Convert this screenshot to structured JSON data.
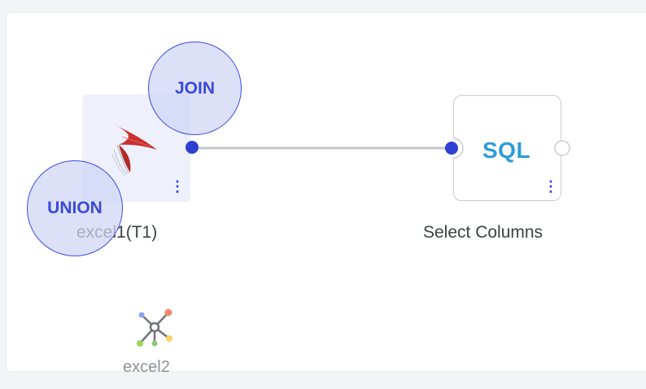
{
  "nodes": {
    "source": {
      "label": "excel1(T1)",
      "more": "⋮"
    },
    "sql": {
      "badge": "SQL",
      "label": "Select Columns",
      "more": "⋮"
    },
    "unconnected": {
      "label": "excel2"
    }
  },
  "actions": {
    "join": "JOIN",
    "union": "UNION"
  },
  "colors": {
    "accent": "#2e3fd3",
    "sql": "#2b9cd8",
    "source_logo": "#c8302c"
  },
  "icons": {
    "source_logo": "sql-server-logo-icon",
    "excel2_icon": "graph-network-icon"
  }
}
